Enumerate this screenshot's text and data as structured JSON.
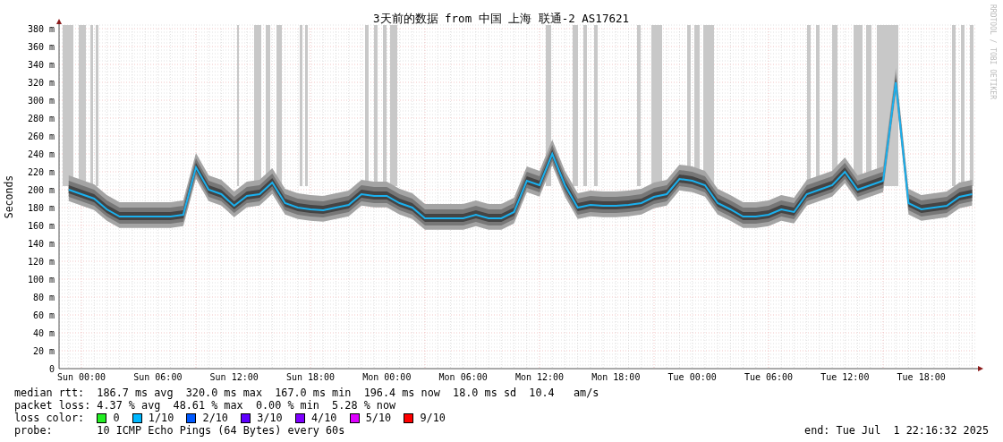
{
  "graph": {
    "watermark": "RRDTOOL / TOBI OETIKER",
    "chart_data": {
      "type": "line",
      "title": "3天前的数据 from 中国 上海 联通-2 AS17621",
      "ylabel": "Seconds",
      "grid": true,
      "ylim": [
        0,
        385
      ],
      "categories": [
        null,
        "Sun 00:00",
        null,
        null,
        null,
        null,
        null,
        "Sun 06:00",
        null,
        null,
        null,
        null,
        null,
        "Sun 12:00",
        null,
        null,
        null,
        null,
        null,
        "Sun 18:00",
        null,
        null,
        null,
        null,
        null,
        "Mon 00:00",
        null,
        null,
        null,
        null,
        null,
        "Mon 06:00",
        null,
        null,
        null,
        null,
        null,
        "Mon 12:00",
        null,
        null,
        null,
        null,
        null,
        "Mon 18:00",
        null,
        null,
        null,
        null,
        null,
        "Tue 00:00",
        null,
        null,
        null,
        null,
        null,
        "Tue 06:00",
        null,
        null,
        null,
        null,
        null,
        "Tue 12:00",
        null,
        null,
        null,
        null,
        null,
        "Tue 18:00",
        null,
        null,
        null,
        null
      ],
      "series": [
        {
          "color": "#1ab0ee",
          "values": [
            200,
            195,
            190,
            178,
            170,
            170,
            170,
            170,
            170,
            172,
            225,
            200,
            195,
            182,
            193,
            195,
            208,
            185,
            180,
            178,
            177,
            180,
            183,
            195,
            193,
            193,
            185,
            180,
            168,
            168,
            168,
            168,
            172,
            168,
            168,
            175,
            210,
            205,
            240,
            205,
            180,
            183,
            182,
            182,
            183,
            185,
            192,
            195,
            212,
            210,
            205,
            185,
            178,
            170,
            170,
            172,
            178,
            175,
            195,
            200,
            205,
            220,
            200,
            205,
            210,
            320,
            185,
            178,
            180,
            182,
            192,
            195
          ]
        }
      ],
      "yticks": [
        {
          "value": 0,
          "label": "0"
        },
        {
          "value": 20,
          "label": "20 m"
        },
        {
          "value": 40,
          "label": "40 m"
        },
        {
          "value": 60,
          "label": "60 m"
        },
        {
          "value": 80,
          "label": "80 m"
        },
        {
          "value": 100,
          "label": "100 m"
        },
        {
          "value": 120,
          "label": "120 m"
        },
        {
          "value": 140,
          "label": "140 m"
        },
        {
          "value": 160,
          "label": "160 m"
        },
        {
          "value": 180,
          "label": "180 m"
        },
        {
          "value": 200,
          "label": "200 m"
        },
        {
          "value": 220,
          "label": "220 m"
        },
        {
          "value": 240,
          "label": "240 m"
        },
        {
          "value": 260,
          "label": "260 m"
        },
        {
          "value": 280,
          "label": "280 m"
        },
        {
          "value": 300,
          "label": "300 m"
        },
        {
          "value": 320,
          "label": "320 m"
        },
        {
          "value": 340,
          "label": "340 m"
        },
        {
          "value": 360,
          "label": "360 m"
        },
        {
          "value": 380,
          "label": "380 m"
        }
      ]
    }
  },
  "legend": {
    "rows": [
      {
        "label": "median rtt:",
        "text": "186.7 ms avg  320.0 ms max  167.0 ms min  196.4 ms now  18.0 ms sd  10.4   am/s"
      },
      {
        "label": "packet loss:",
        "text": "4.37 % avg  48.61 % max  0.00 % min  5.28 % now"
      }
    ],
    "loss_color": {
      "label": "loss color:",
      "items": [
        {
          "label": "0",
          "color": "#22ee22"
        },
        {
          "label": "1/10",
          "color": "#00b8ff"
        },
        {
          "label": "2/10",
          "color": "#0059ff"
        },
        {
          "label": "3/10",
          "color": "#5e00ff"
        },
        {
          "label": "4/10",
          "color": "#7e00ff"
        },
        {
          "label": "5/10",
          "color": "#dd00ff"
        },
        {
          "label": "9/10",
          "color": "#ff0000"
        }
      ]
    },
    "probe": {
      "label": "probe:",
      "text": "10 ICMP Echo Pings (64 Bytes) every 60s"
    },
    "end": "end: Tue Jul  1 22:16:32 2025"
  }
}
